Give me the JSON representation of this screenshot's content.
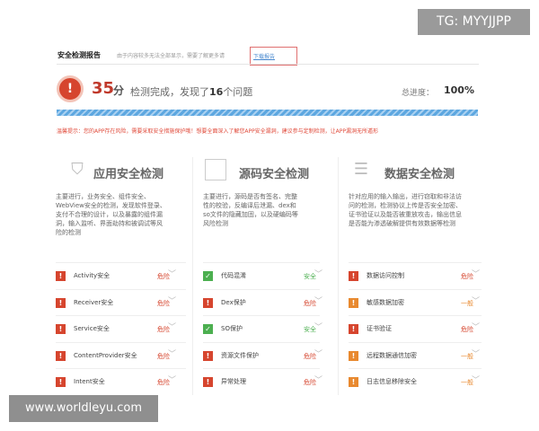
{
  "overlay_top": "TG: MYYJJPP",
  "overlay_bottom": "www.worldleyu.com",
  "header": {
    "title": "安全检测报告",
    "note": "由于内容较多无法全部显示，需要了解更多请",
    "link": "下载报告"
  },
  "score": {
    "value": "35",
    "unit": "分",
    "text_pre": "检测完成，发现了",
    "count": "16",
    "text_post": "个问题",
    "progress_label": "总进度：",
    "progress_value": "100%",
    "progress": 100
  },
  "warning": "温馨提示：您的APP存在风险，需要采取安全措施保护哦！想要全面深入了解您APP安全漏洞，建议参与定制检测，让APP漏洞无所遁形",
  "colors": {
    "danger": "#d6452e",
    "warn": "#e8892f",
    "safe": "#4caf50"
  },
  "columns": [
    {
      "title": "应用安全检测",
      "icon": "shield-icon",
      "desc": "主要进行，业务安全、组件安全、WebView安全的检测，发现软件登录、支付不合理的设计，以及暴露的组件漏洞，输入监听、界面劫持和被调试等风险的检测",
      "items": [
        {
          "label": "Activity安全",
          "status": "危险",
          "level": "danger"
        },
        {
          "label": "Receiver安全",
          "status": "危险",
          "level": "danger"
        },
        {
          "label": "Service安全",
          "status": "危险",
          "level": "danger"
        },
        {
          "label": "ContentProvider安全",
          "status": "危险",
          "level": "danger"
        },
        {
          "label": "Intent安全",
          "status": "危险",
          "level": "danger"
        }
      ]
    },
    {
      "title": "源码安全检测",
      "icon": "code-icon",
      "desc": "主要进行，源码是否有签名、完整性的校验，反编译后泄漏、dex和so文件的隐藏加固，以及硬编码等风险检测",
      "items": [
        {
          "label": "代码混淆",
          "status": "安全",
          "level": "safe"
        },
        {
          "label": "Dex保护",
          "status": "危险",
          "level": "danger"
        },
        {
          "label": "SO保护",
          "status": "安全",
          "level": "safe"
        },
        {
          "label": "资源文件保护",
          "status": "危险",
          "level": "danger"
        },
        {
          "label": "异常处理",
          "status": "危险",
          "level": "danger"
        }
      ]
    },
    {
      "title": "数据安全检测",
      "icon": "server-icon",
      "desc": "针对应用的输入输出，进行窃取和非法访问的检测，检测协议上传是否安全加密、证书验证以及能否被重放攻击，输出信息是否能为渗透破解提供有效数据等检测",
      "items": [
        {
          "label": "数据访问控制",
          "status": "危险",
          "level": "danger"
        },
        {
          "label": "敏感数据加密",
          "status": "一般",
          "level": "warn"
        },
        {
          "label": "证书验证",
          "status": "危险",
          "level": "danger"
        },
        {
          "label": "远程数据通信加密",
          "status": "一般",
          "level": "warn"
        },
        {
          "label": "日志信息移除安全",
          "status": "一般",
          "level": "warn"
        }
      ]
    }
  ]
}
